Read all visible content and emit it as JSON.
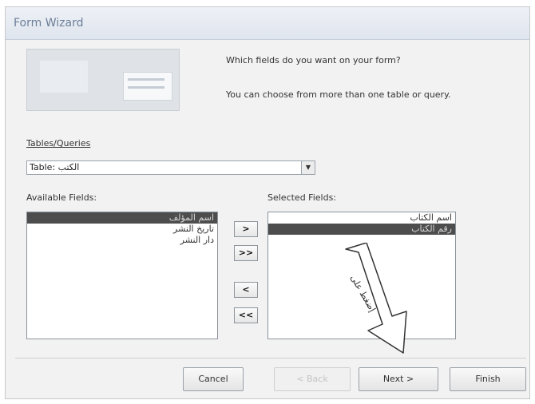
{
  "window": {
    "title": "Form Wizard"
  },
  "prompt": {
    "question": "Which fields do you want on your form?",
    "hint": "You can choose from more than one table or query."
  },
  "tables": {
    "label": "Tables/Queries",
    "selected_value": "Table: الكتب"
  },
  "available": {
    "label": "Available Fields:",
    "items": [
      "اسم المؤلف",
      "تاريخ النشر",
      "دار النشر"
    ],
    "selected_index": 0
  },
  "selected": {
    "label": "Selected Fields:",
    "items": [
      "اسم الكتاب",
      "رقم الكتاب"
    ],
    "selected_index": 1
  },
  "move_buttons": {
    "add_one": ">",
    "add_all": ">>",
    "remove_one": "<",
    "remove_all": "<<"
  },
  "footer": {
    "cancel": "Cancel",
    "back": "< Back",
    "next": "Next >",
    "finish": "Finish"
  },
  "annotation": {
    "text": "إضغط على"
  },
  "colors": {
    "selection": "#4d4d4d",
    "title_text": "#6c7f98"
  }
}
